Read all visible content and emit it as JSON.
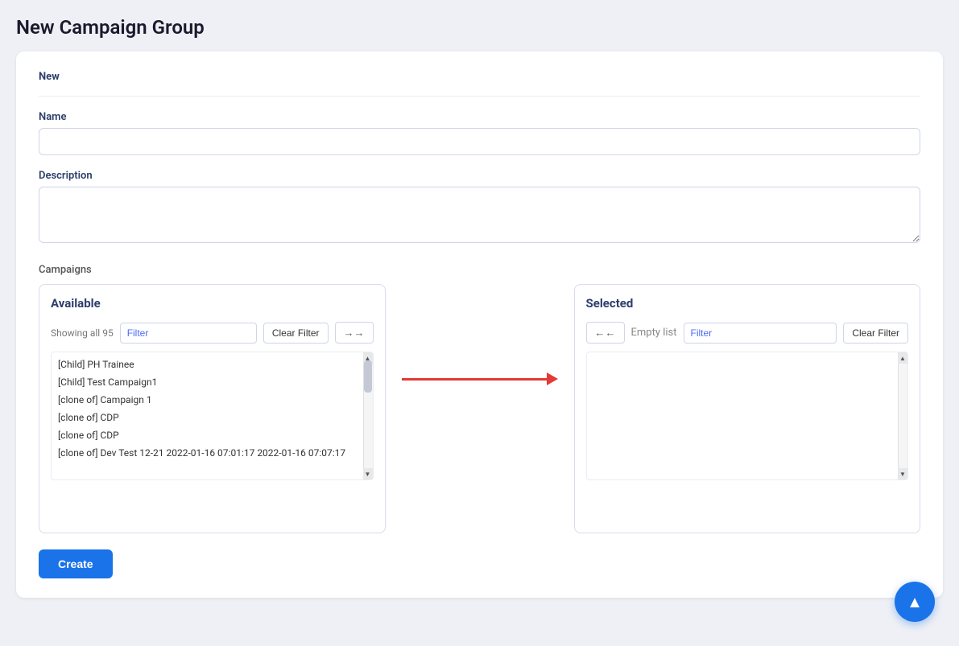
{
  "page": {
    "title": "New Campaign Group"
  },
  "form": {
    "section_label": "New",
    "name_label": "Name",
    "name_placeholder": "",
    "description_label": "Description",
    "description_placeholder": "",
    "campaigns_label": "Campaigns"
  },
  "available_list": {
    "title": "Available",
    "showing_text": "Showing all 95",
    "filter_placeholder": "Filter",
    "clear_filter_label": "Clear Filter",
    "move_all_label": "→→",
    "items": [
      "[Child] PH Trainee",
      "[Child] Test Campaign1",
      "[clone of] Campaign 1",
      "[clone of] CDP",
      "[clone of] CDP",
      "[clone of] Dev Test 12-21 2022-01-16 07:01:17 2022-01-16 07:07:17"
    ]
  },
  "selected_list": {
    "title": "Selected",
    "empty_text": "Empty list",
    "filter_placeholder": "Filter",
    "clear_filter_label": "Clear Filter",
    "move_all_back_label": "←←",
    "items": []
  },
  "actions": {
    "create_label": "Create"
  },
  "fab": {
    "icon": "▲"
  }
}
